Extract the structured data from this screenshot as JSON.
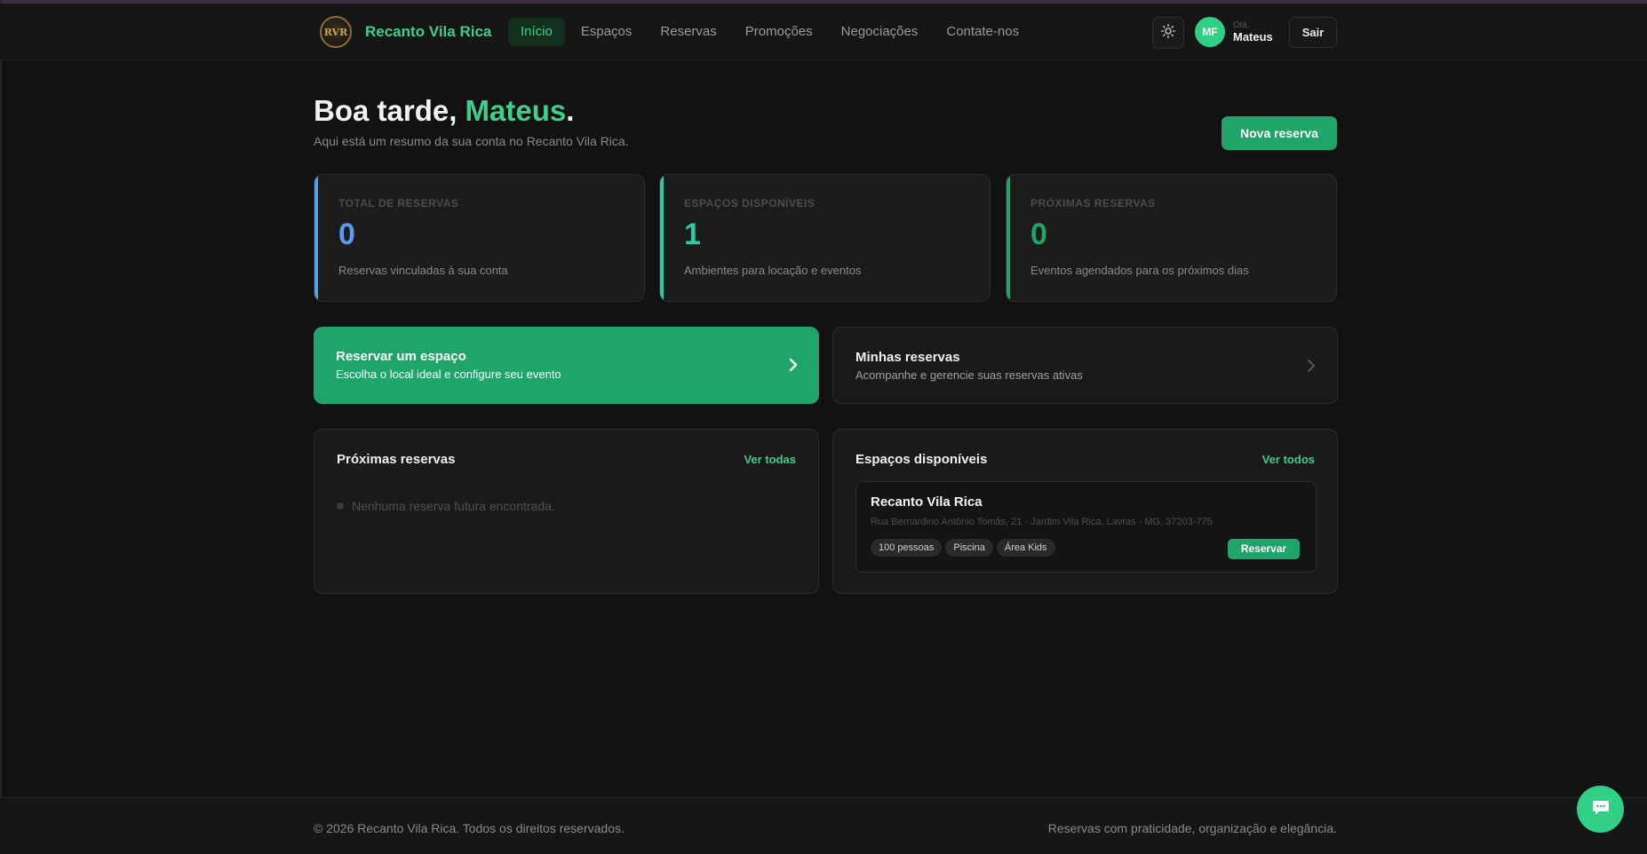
{
  "header": {
    "logo_text": "RVR",
    "brand": "Recanto Vila Rica",
    "nav": [
      {
        "label": "Início",
        "active": true
      },
      {
        "label": "Espaços",
        "active": false
      },
      {
        "label": "Reservas",
        "active": false
      },
      {
        "label": "Promoções",
        "active": false
      },
      {
        "label": "Negociações",
        "active": false
      },
      {
        "label": "Contate-nos",
        "active": false
      }
    ],
    "theme_icon": "sun-icon",
    "avatar_initials": "MF",
    "greeting_small": "Olá,",
    "user_name": "Mateus",
    "logout": "Sair"
  },
  "hero": {
    "greeting_prefix": "Boa tarde, ",
    "greeting_name": "Mateus",
    "greeting_suffix": ".",
    "subtitle": "Aqui está um resumo da sua conta no Recanto Vila Rica.",
    "new_booking": "Nova reserva"
  },
  "stats": [
    {
      "label": "TOTAL DE RESERVAS",
      "value": "0",
      "desc": "Reservas vinculadas à sua conta",
      "color": "#5b9cf2"
    },
    {
      "label": "ESPAÇOS DISPONÍVEIS",
      "value": "1",
      "desc": "Ambientes para locação e eventos",
      "color": "#2fc9a8"
    },
    {
      "label": "PRÓXIMAS RESERVAS",
      "value": "0",
      "desc": "Eventos agendados para os próximos dias",
      "color": "#1fa56a"
    }
  ],
  "actions": {
    "primary": {
      "title": "Reservar um espaço",
      "subtitle": "Escolha o local ideal e configure seu evento"
    },
    "secondary": {
      "title": "Minhas reservas",
      "subtitle": "Acompanhe e gerencie suas reservas ativas"
    }
  },
  "upcoming": {
    "title": "Próximas reservas",
    "link": "Ver todas",
    "empty": "Nenhuma reserva futura encontrada."
  },
  "spaces": {
    "title": "Espaços disponíveis",
    "link": "Ver todos",
    "items": [
      {
        "name": "Recanto Vila Rica",
        "address": "Rua Bernardino Antônio Tomás, 21 - Jardim Vila Rica, Lavras - MG, 37203-775",
        "tags": [
          "100 pessoas",
          "Piscina",
          "Área Kids"
        ],
        "button": "Reservar"
      }
    ]
  },
  "footer": {
    "copyright": "© 2026 Recanto Vila Rica. Todos os direitos reservados.",
    "tagline": "Reservas com praticidade, organização e elegância."
  },
  "colors": {
    "accent": "#3fcf8a",
    "button": "#1fa56a",
    "background": "#121212"
  }
}
